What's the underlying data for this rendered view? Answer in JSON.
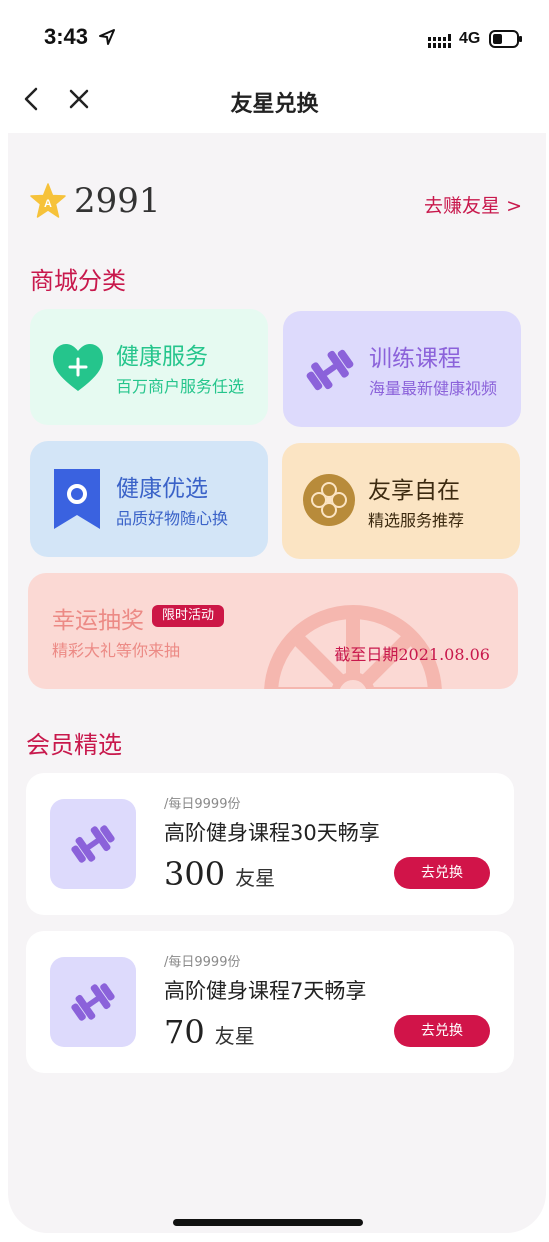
{
  "status_bar": {
    "time": "3:43",
    "network": "4G"
  },
  "nav": {
    "title": "友星兑换"
  },
  "points": {
    "value": "2991",
    "earn_link": "去赚友星 >"
  },
  "sections": {
    "categories_title": "商城分类",
    "members_title": "会员精选"
  },
  "categories": [
    {
      "title": "健康服务",
      "subtitle": "百万商户服务任选",
      "bg": "#e6faf1",
      "color": "#25c58c"
    },
    {
      "title": "训练课程",
      "subtitle": "海量最新健康视频",
      "bg": "#dddafc",
      "color": "#8b62da"
    },
    {
      "title": "健康优选",
      "subtitle": "品质好物随心换",
      "bg": "#d3e5f7",
      "color": "#3a62c8"
    },
    {
      "title": "友享自在",
      "subtitle": "精选服务推荐",
      "bg": "#fbe4c3",
      "color": "#3c2a10"
    }
  ],
  "lottery": {
    "title": "幸运抽奖",
    "badge": "限时活动",
    "subtitle": "精彩大礼等你来抽",
    "deadline": "截至日期2021.08.06"
  },
  "products": [
    {
      "limit": "/每日9999份",
      "name": "高阶健身课程30天畅享",
      "price": "300",
      "unit": "友星",
      "button": "去兑换"
    },
    {
      "limit": "/每日9999份",
      "name": "高阶健身课程7天畅享",
      "price": "70",
      "unit": "友星",
      "button": "去兑换"
    }
  ],
  "colors": {
    "accent": "#c8184c",
    "button": "#d11449"
  }
}
